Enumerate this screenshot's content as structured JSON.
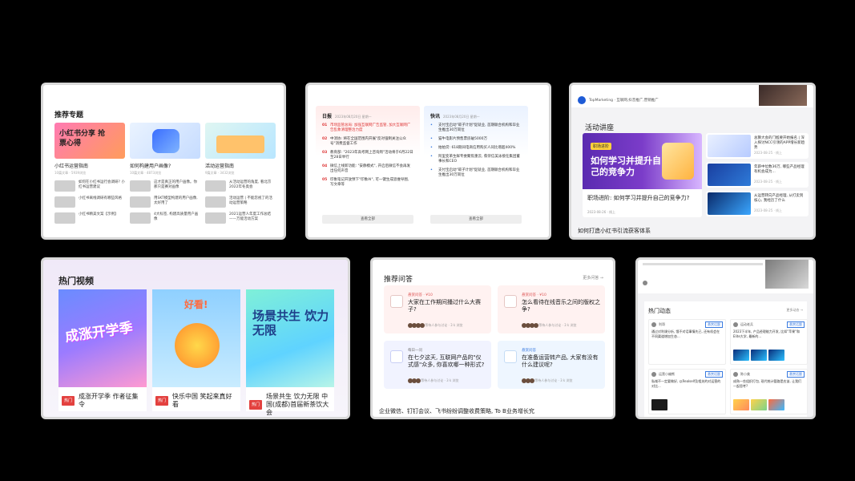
{
  "topics": {
    "title": "推荐专题",
    "columns": [
      {
        "name": "小红书运营指南",
        "meta": "10篇文章 · 5939浏览",
        "thumb_text": "小红书分享 抢票心得",
        "items": [
          "如何在小红书运行会调研? 小红书运营建议",
          "小红书离线调研有哪些风格",
          "小红书精美文案【示例】"
        ]
      },
      {
        "name": "如何构建用户画像?",
        "meta": "10篇文章 · 4873浏览",
        "thumb_text": "",
        "items": [
          "这才是真正的用户画像。你那只是赛对画像",
          "用SKT模型构建的用户画像, 太好用了",
          "4大标签, 构建高质量用户画像"
        ]
      },
      {
        "name": "活动运营指南",
        "meta": "9篇文章 · 3432浏览",
        "thumb_text": "",
        "items": [
          "从活动运营的角度, 看北京2022年冬奥会",
          "活动运营 | 不能忽视了的活动运营策略",
          "2021运营人年度工作总结——万能活动方案"
        ]
      }
    ]
  },
  "news": {
    "daily": {
      "title": "日报",
      "date": "2023年08月20日 星期一",
      "items": [
        "市场监管总局: 加强互联网广告监管, 加大互联网广告乱象清理整治力度",
        "中消协: 将在全国范围内开展\"反对强制关注公众号\"消费监督工作",
        "教育部: \"2023年高考网上咨询周\"活动将于6月22日至28日举行",
        "微信上线新功能: \"安静模式\", 开启后微信不会再发出任何声音",
        "印象笔记开放预下\"印象AI\", 可一键生成思维导图, 写文章等"
      ],
      "button": "查看全部"
    },
    "flash": {
      "title": "快讯",
      "date": "2023年08月20日 星期一",
      "items": [
        "支付宝启动\"碳子计划\"促就业, 首期联合机构和毕业生推出30万岗位",
        "猫牛电影片预售票房破5000万",
        "拍拍贷: 618期间电商信用购买人同比增超400%",
        "阿里变革生鲜专委聚焦重云, 蔡崇信美泳接任集团董事长和CEO",
        "支付宝启动\"碳子计划\"促就业, 首期联合机构和毕业生推出30万岗位"
      ],
      "button": "查看全部"
    }
  },
  "events": {
    "header": "TopMarketing · 互联网,抖音推广,营销推广",
    "title": "活动讲座",
    "main": {
      "badge": "职场进阶",
      "banner": "如何学习并提升自己的竞争力",
      "name": "职场进阶: 如何学习并提升自己的竞争力?",
      "meta": "2023-08-26 · 线上"
    },
    "side": [
      {
        "title": "总算大会的门槛要开始报名 | 深入探讨NCC引领的APP增长新趋势",
        "meta": "2023-08-25 · 线上"
      },
      {
        "title": "年薪中位数36万, 哪些产品经理有机会成为...",
        "meta": "2023-08-25 · 线上"
      },
      {
        "title": "从运营转向产品经理, 从打卖到核心, 我经历了什么",
        "meta": "2023-08-25 · 线上"
      }
    ],
    "footer": "如何打造小红书引流获客体系"
  },
  "videos": {
    "title": "热门视频",
    "items": [
      {
        "tag": "热门",
        "caption": "成涨开学季 作者征集令",
        "art": "成涨开学季"
      },
      {
        "tag": "热门",
        "caption": "快乐中国 笑起来真好看",
        "art": "好看!"
      },
      {
        "tag": "热门",
        "caption": "场景共生 饮力无限 中国(成都)首届新茶饮大会",
        "art": "场景共生 饮力无限"
      }
    ]
  },
  "qa": {
    "title": "推荐问答",
    "more": "更多问答 →",
    "items": [
      {
        "tag": "悬赏问答 · ¥10",
        "question": "大家在工作期间播过什么大赛子?",
        "foot": "等待人参与讨论 · 3 k 浏览"
      },
      {
        "tag": "悬赏问答 · ¥10",
        "question": "怎么看待在线音乐之间的版权之争?",
        "foot": "等待人参与讨论 · 3 k 浏览"
      },
      {
        "tag": "每日一问",
        "question": "在七夕这天, 互联网产品的\"仪式感\"众多, 你喜欢哪一种形式?",
        "foot": "等待人参与讨论 · 3 k 浏览"
      },
      {
        "tag": "悬赏问答",
        "question": "在准备运营转产品, 大家有没有什么建议呢?",
        "foot": "等待人参与讨论 · 3 k 浏览"
      }
    ],
    "footer": "企业微信、钉钉会议、飞书纷纷调整收费策略, To B业务增长究"
  },
  "feed": {
    "title": "热门动态",
    "more": "更多动态 →",
    "posts": [
      {
        "name": "利哥",
        "badge": "悬赏话题",
        "text": "通过对利课分析, 饿不对话事情先已, 还有机会在不同渠道增加生态..."
      },
      {
        "name": "运动老兵",
        "badge": "悬赏话题",
        "text": "2023下半年, 产品经理能力开发, 比如\"苹果\"和Elite大学, 最新的..."
      },
      {
        "name": "运营小编熊",
        "badge": "悬赏话题",
        "text": "私域不一定要做好, 以Realself及相关的对运营的对比..."
      },
      {
        "name": "陈小美",
        "badge": "悬赏话题",
        "text": "成熟一些组织打包, 现代统计管路是应该, 让我们一起思考?"
      }
    ]
  },
  "colors": {
    "accent": "#e3413f",
    "link": "#3a7be0"
  }
}
